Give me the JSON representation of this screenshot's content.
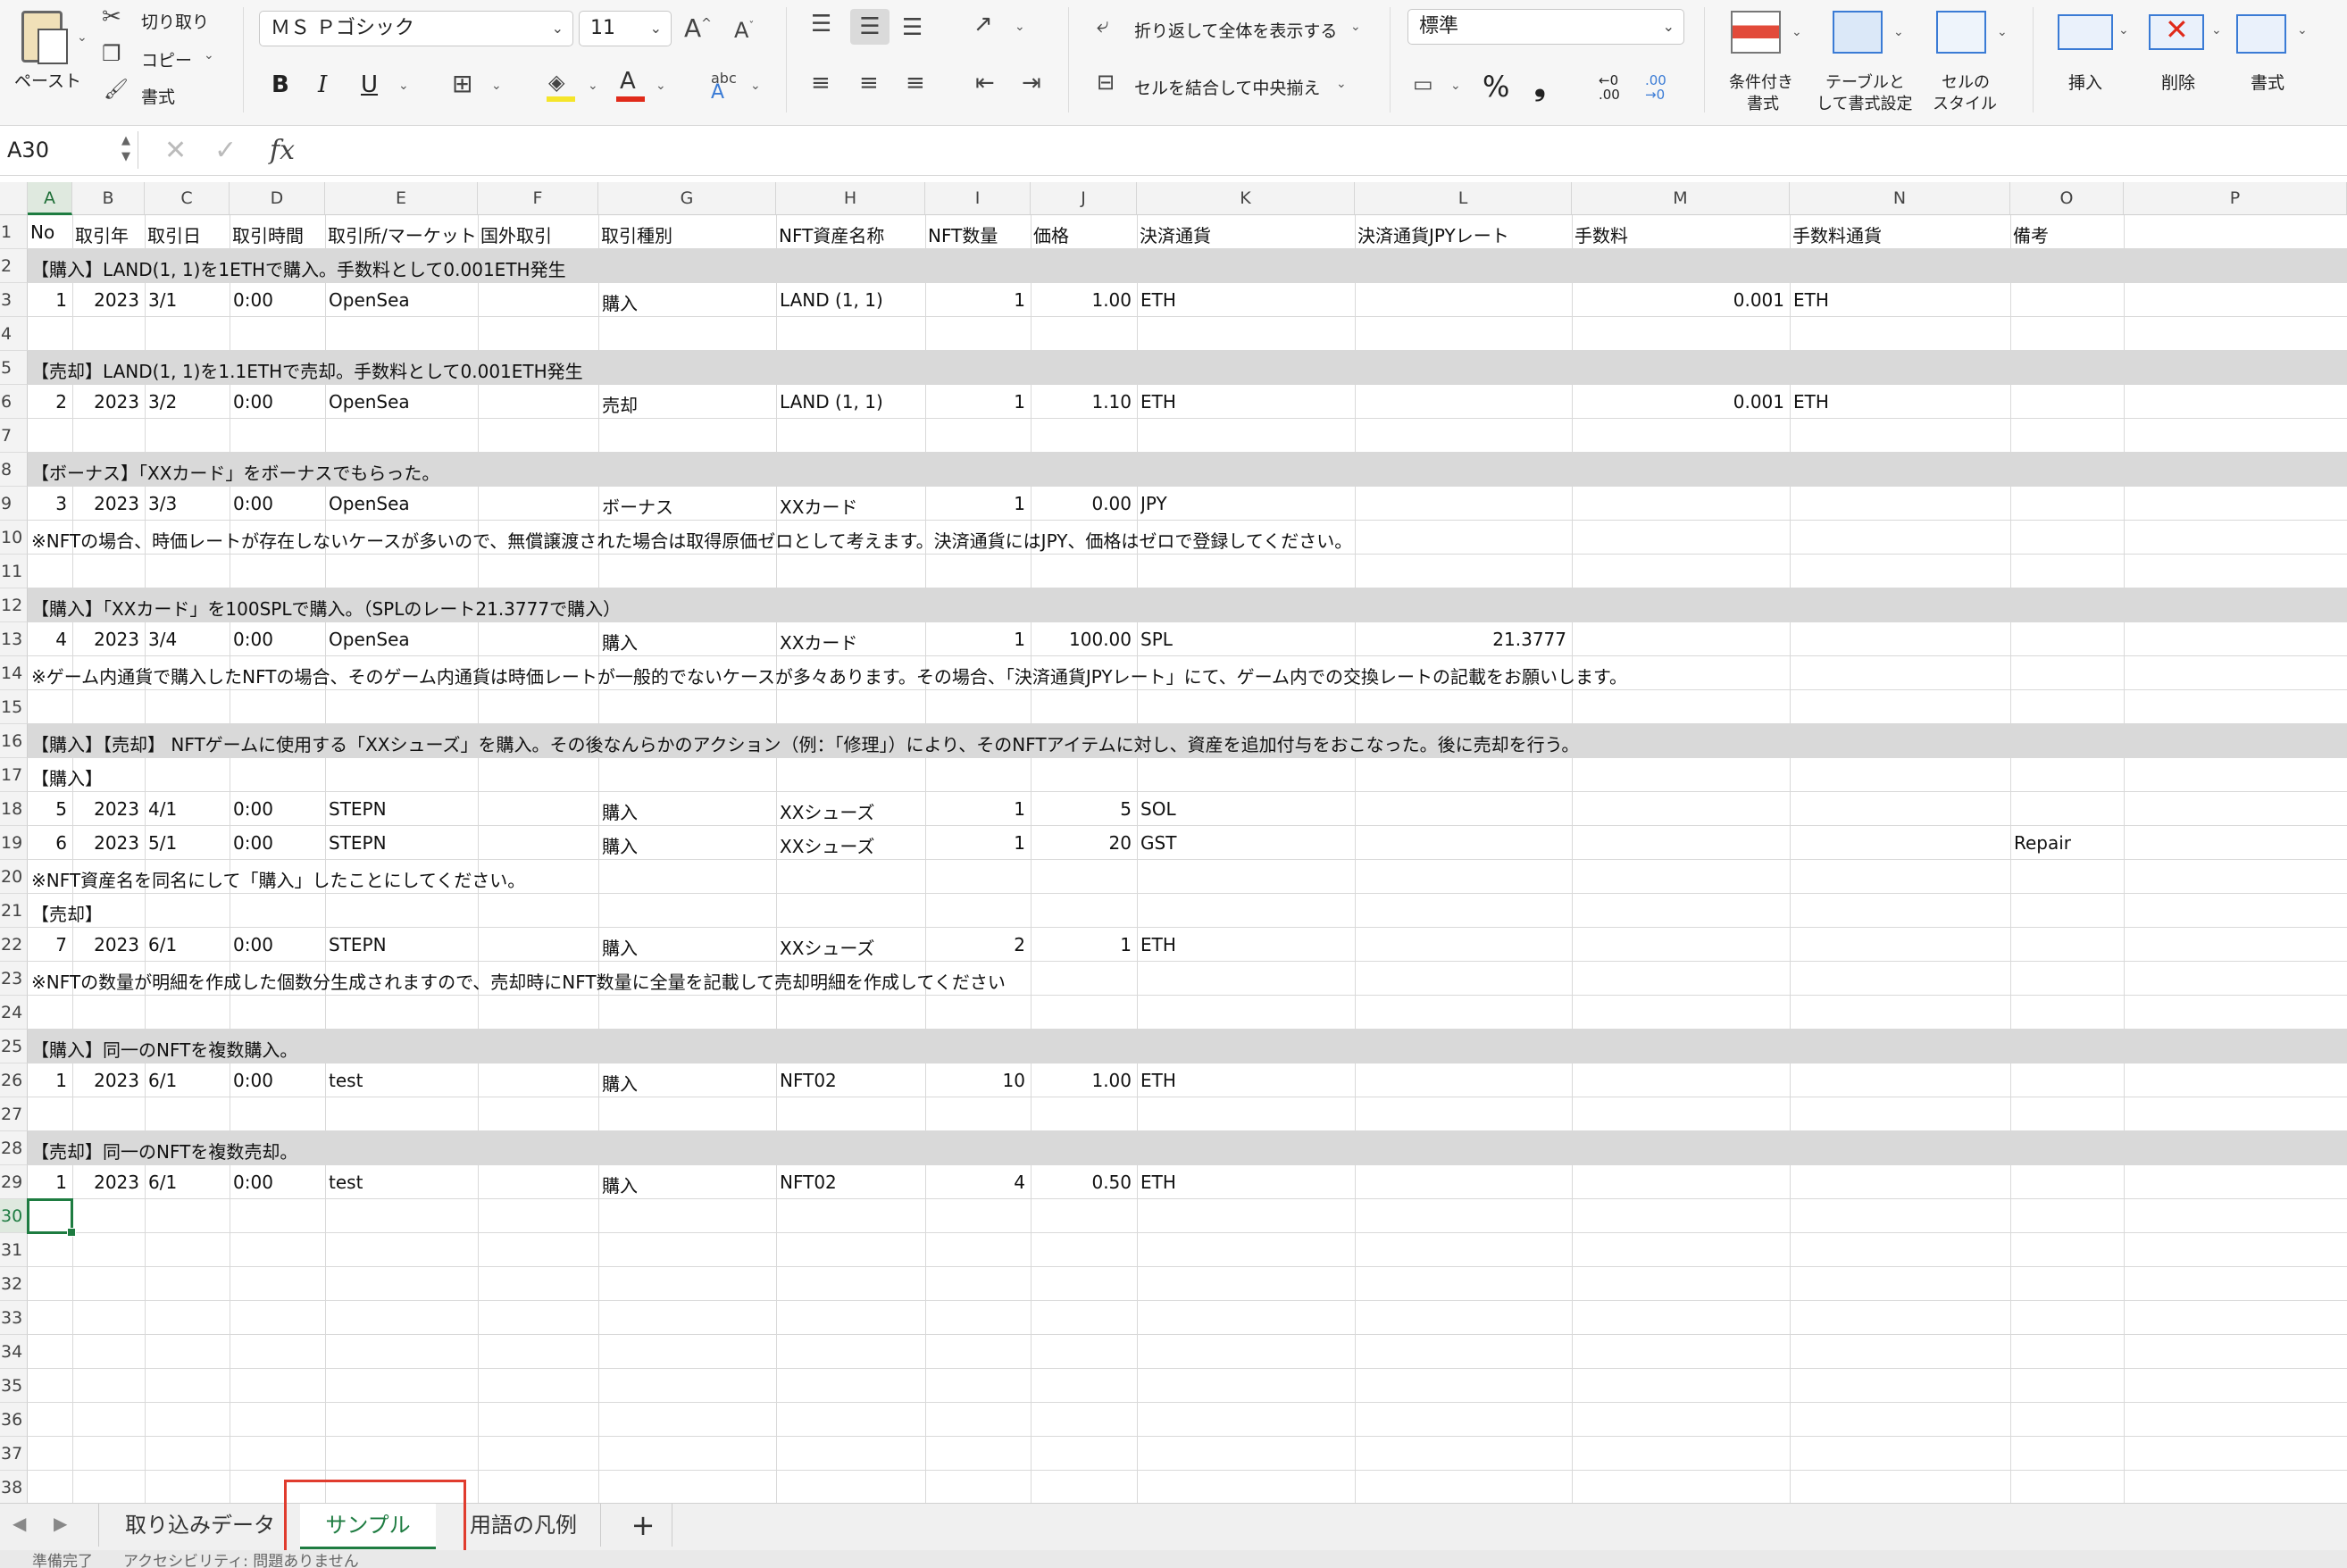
{
  "ribbon": {
    "paste": "ペースト",
    "cut": "切り取り",
    "copy": "コピー",
    "format_painter": "書式",
    "font_name": "ＭＳ Ｐゴシック",
    "font_size": "11",
    "bold": "B",
    "italic": "I",
    "underline": "U",
    "wrap_text": "折り返して全体を表示する",
    "merge_center": "セルを結合して中央揃え",
    "number_format": "標準",
    "percent": "%",
    "comma": "❟",
    "dec_inc": "←0 .00",
    "dec_dec": ".00 →0",
    "cond_format": [
      "条件付き",
      "書式"
    ],
    "table_format": [
      "テーブルと",
      "して書式設定"
    ],
    "cell_style": [
      "セルの",
      "スタイル"
    ],
    "insert": "挿入",
    "delete": "削除",
    "format": "書式"
  },
  "formula_bar": {
    "name_box": "A30",
    "fx": "fx",
    "value": ""
  },
  "grid": {
    "columns": [
      "A",
      "B",
      "C",
      "D",
      "E",
      "F",
      "G",
      "H",
      "I",
      "J",
      "K",
      "L",
      "M",
      "N",
      "O",
      "P"
    ],
    "selected_column": "A",
    "row_numbers": [
      "1",
      "2",
      "3",
      "4",
      "5",
      "6",
      "7",
      "8",
      "9",
      "10",
      "11",
      "12",
      "13",
      "14",
      "15",
      "16",
      "17",
      "18",
      "19",
      "20",
      "21",
      "22",
      "23",
      "24",
      "25",
      "26",
      "27",
      "28",
      "29",
      "30",
      "31",
      "32",
      "33",
      "34",
      "35",
      "36",
      "37",
      "38"
    ],
    "selected_row": "30",
    "header": [
      "No",
      "取引年",
      "取引日",
      "取引時間",
      "取引所/マーケット",
      "国外取引",
      "取引種別",
      "NFT資産名称",
      "NFT数量",
      "価格",
      "決済通貨",
      "決済通貨JPYレート",
      "手数料",
      "手数料通貨",
      "備考"
    ],
    "rows": [
      {
        "r": 2,
        "band": true,
        "note": "【購入】LAND(1, 1)を1ETHで購入。手数料として0.001ETH発生"
      },
      {
        "r": 3,
        "cells": {
          "A": "1",
          "B": "2023",
          "C": "3/1",
          "D": "0:00",
          "E": "OpenSea",
          "G": "購入",
          "H": "LAND (1, 1)",
          "I": "1",
          "J": "1.00",
          "K": "ETH",
          "M": "0.001",
          "N": "ETH"
        }
      },
      {
        "r": 5,
        "band": true,
        "note": "【売却】LAND(1, 1)を1.1ETHで売却。手数料として0.001ETH発生"
      },
      {
        "r": 6,
        "cells": {
          "A": "2",
          "B": "2023",
          "C": "3/2",
          "D": "0:00",
          "E": "OpenSea",
          "G": "売却",
          "H": "LAND (1, 1)",
          "I": "1",
          "J": "1.10",
          "K": "ETH",
          "M": "0.001",
          "N": "ETH"
        }
      },
      {
        "r": 8,
        "band": true,
        "note": "【ボーナス】「XXカード」をボーナスでもらった。"
      },
      {
        "r": 9,
        "cells": {
          "A": "3",
          "B": "2023",
          "C": "3/3",
          "D": "0:00",
          "E": "OpenSea",
          "G": "ボーナス",
          "H": "XXカード",
          "I": "1",
          "J": "0.00",
          "K": "JPY"
        }
      },
      {
        "r": 10,
        "note": "※NFTの場合、時価レートが存在しないケースが多いので、無償譲渡された場合は取得原価ゼロとして考えます。決済通貨にはJPY、価格はゼロで登録してください。"
      },
      {
        "r": 12,
        "band": true,
        "note": "【購入】「XXカード」を100SPLで購入。（SPLのレート21.3777で購入）"
      },
      {
        "r": 13,
        "cells": {
          "A": "4",
          "B": "2023",
          "C": "3/4",
          "D": "0:00",
          "E": "OpenSea",
          "G": "購入",
          "H": "XXカード",
          "I": "1",
          "J": "100.00",
          "K": "SPL",
          "L": "21.3777"
        }
      },
      {
        "r": 14,
        "note": "※ゲーム内通貨で購入したNFTの場合、そのゲーム内通貨は時価レートが一般的でないケースが多々あります。その場合、「決済通貨JPYレート」にて、ゲーム内での交換レートの記載をお願いします。"
      },
      {
        "r": 16,
        "band": true,
        "note": "【購入】【売却】 NFTゲームに使用する「XXシューズ」を購入。その後なんらかのアクション（例：「修理」）により、そのNFTアイテムに対し、資産を追加付与をおこなった。後に売却を行う。"
      },
      {
        "r": 17,
        "note": "【購入】"
      },
      {
        "r": 18,
        "cells": {
          "A": "5",
          "B": "2023",
          "C": "4/1",
          "D": "0:00",
          "E": "STEPN",
          "G": "購入",
          "H": "XXシューズ",
          "I": "1",
          "J": "5",
          "K": "SOL"
        }
      },
      {
        "r": 19,
        "cells": {
          "A": "6",
          "B": "2023",
          "C": "5/1",
          "D": "0:00",
          "E": "STEPN",
          "G": "購入",
          "H": "XXシューズ",
          "I": "1",
          "J": "20",
          "K": "GST",
          "O": "Repair"
        }
      },
      {
        "r": 20,
        "note": "※NFT資産名を同名にして「購入」したことにしてください。"
      },
      {
        "r": 21,
        "note": "【売却】"
      },
      {
        "r": 22,
        "cells": {
          "A": "7",
          "B": "2023",
          "C": "6/1",
          "D": "0:00",
          "E": "STEPN",
          "G": "購入",
          "H": "XXシューズ",
          "I": "2",
          "J": "1",
          "K": "ETH"
        }
      },
      {
        "r": 23,
        "note": "※NFTの数量が明細を作成した個数分生成されますので、売却時にNFT数量に全量を記載して売却明細を作成してください"
      },
      {
        "r": 25,
        "band": true,
        "note": "【購入】同一のNFTを複数購入。"
      },
      {
        "r": 26,
        "cells": {
          "A": "1",
          "B": "2023",
          "C": "6/1",
          "D": "0:00",
          "E": "test",
          "G": "購入",
          "H": "NFT02",
          "I": "10",
          "J": "1.00",
          "K": "ETH"
        }
      },
      {
        "r": 28,
        "band": true,
        "note": "【売却】同一のNFTを複数売却。"
      },
      {
        "r": 29,
        "cells": {
          "A": "1",
          "B": "2023",
          "C": "6/1",
          "D": "0:00",
          "E": "test",
          "G": "購入",
          "H": "NFT02",
          "I": "4",
          "J": "0.50",
          "K": "ETH"
        }
      }
    ]
  },
  "tabs": {
    "prev": "◀",
    "next": "▶",
    "items": [
      "取り込みデータ",
      "サンプル",
      "用語の凡例"
    ],
    "active": "サンプル",
    "add": "+"
  },
  "status": "準備完了　　アクセシビリティ: 問題ありません"
}
